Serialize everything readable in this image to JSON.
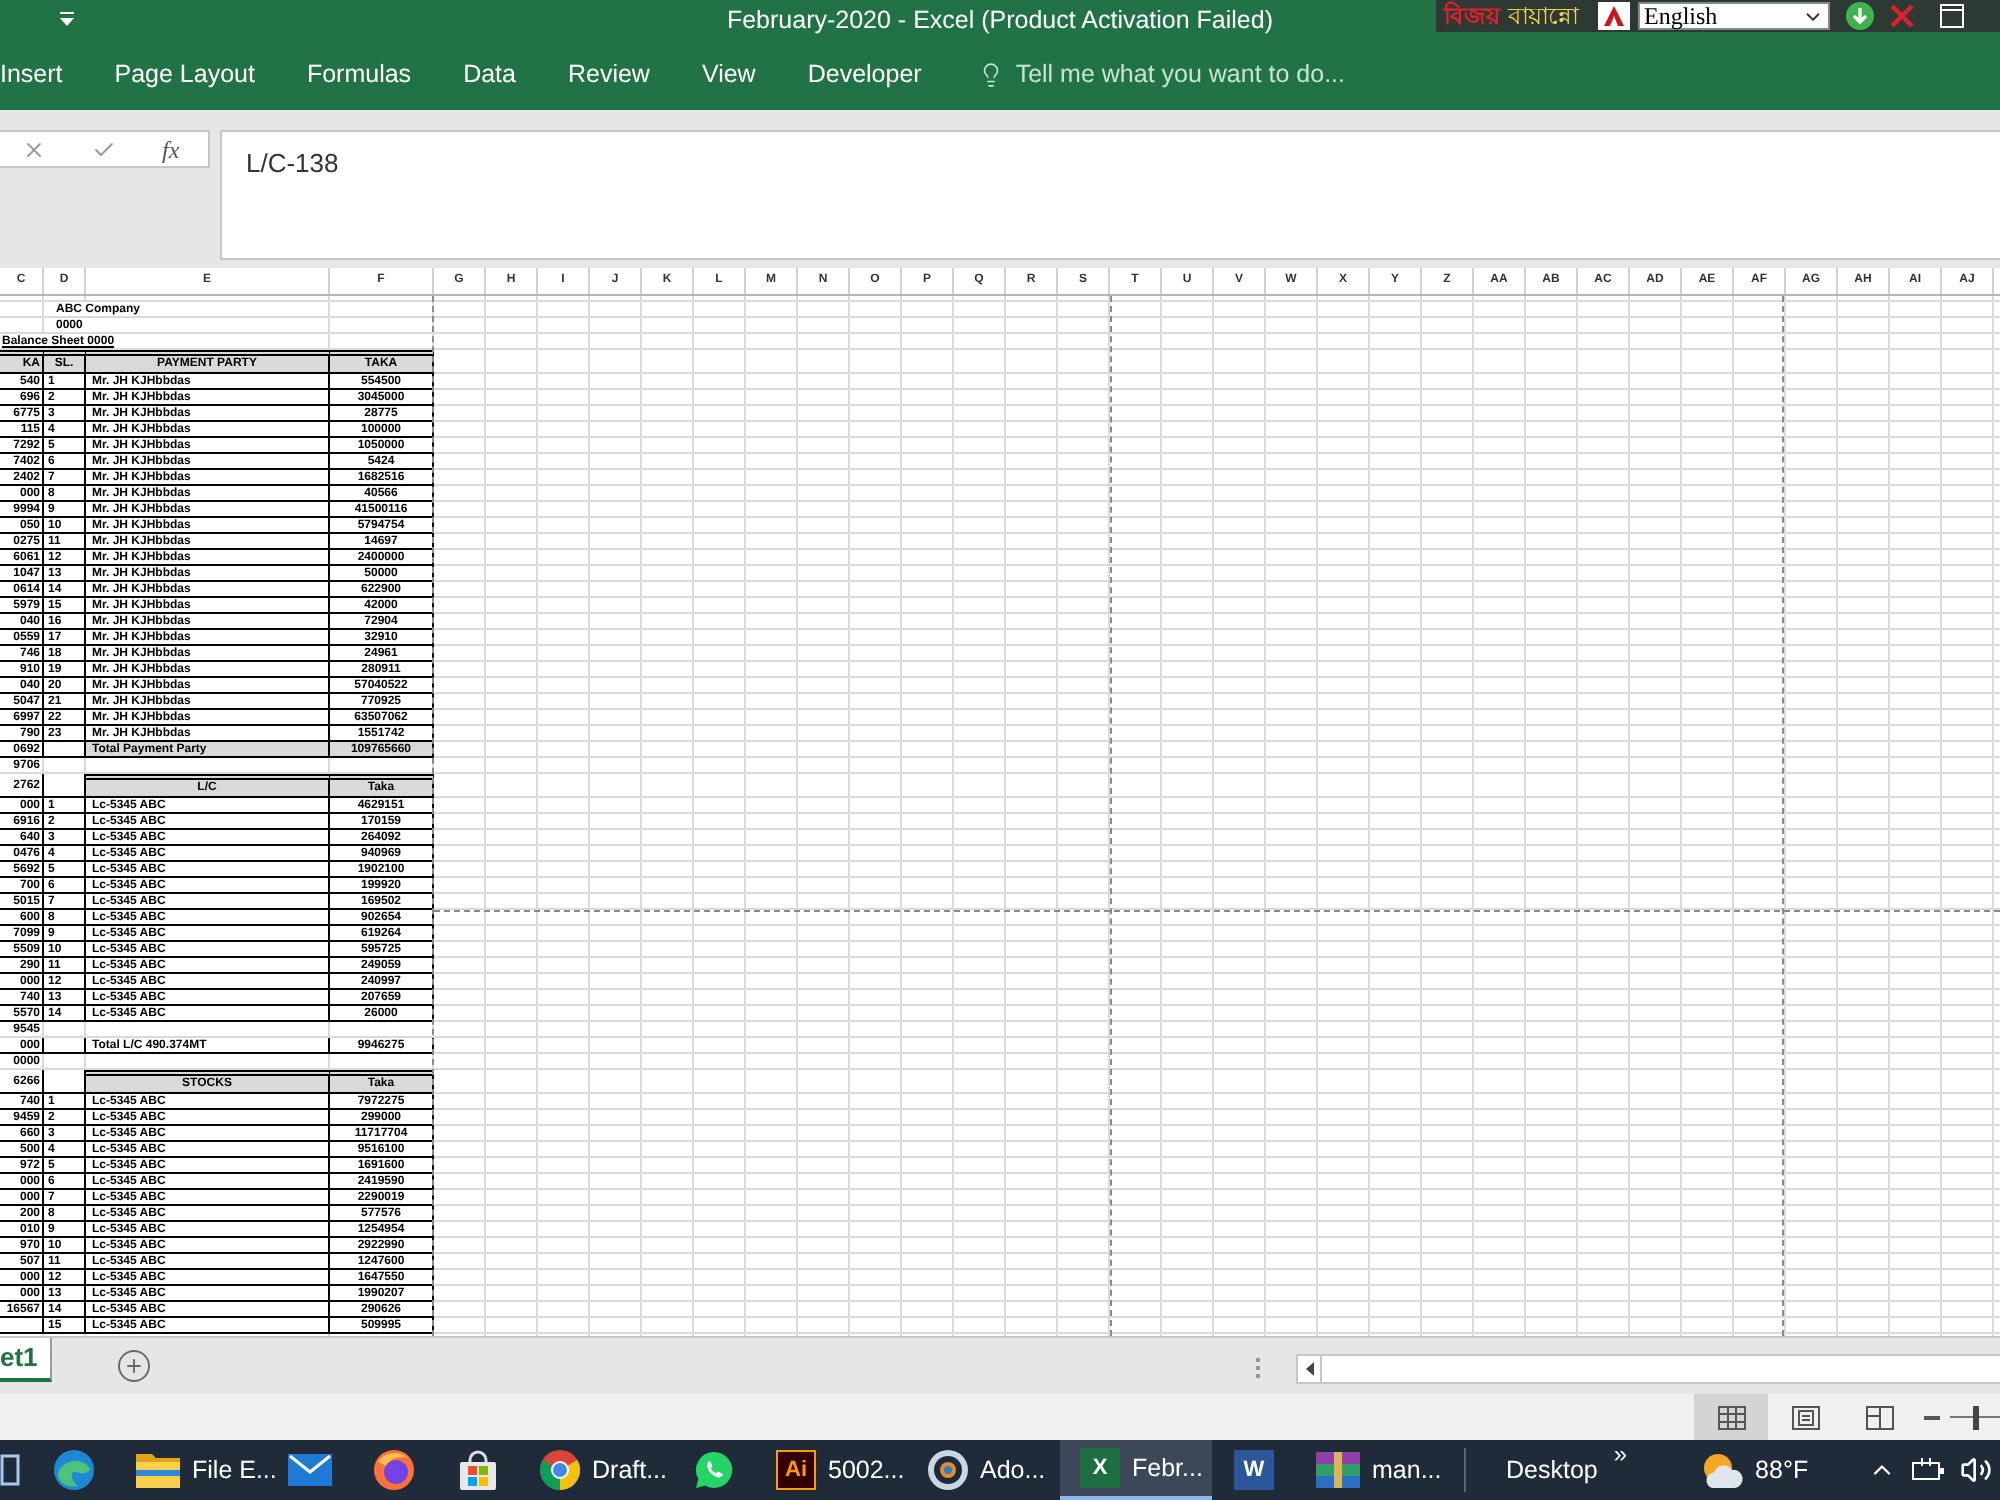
{
  "title_bar": {
    "title": "February-2020 - Excel (Product Activation Failed)"
  },
  "keyboard_toolbar": {
    "brand": "বিজয়",
    "name": "বায়ান্নো",
    "language": "English"
  },
  "ribbon_tabs": [
    {
      "label": "Insert",
      "selected": false
    },
    {
      "label": "Page Layout",
      "selected": false
    },
    {
      "label": "Formulas",
      "selected": false
    },
    {
      "label": "Data",
      "selected": false
    },
    {
      "label": "Review",
      "selected": false
    },
    {
      "label": "View",
      "selected": false
    },
    {
      "label": "Developer",
      "selected": false
    }
  ],
  "tell_me": {
    "placeholder": "Tell me what you want to do..."
  },
  "formula_bar": {
    "function_label": "fx",
    "value": "L/C-138"
  },
  "sheet": {
    "columns": [
      "C",
      "D",
      "E",
      "F",
      "G",
      "H",
      "I",
      "J",
      "K",
      "L",
      "M",
      "N",
      "O",
      "P",
      "Q",
      "R",
      "S",
      "T",
      "U",
      "V",
      "W",
      "X",
      "Y",
      "Z",
      "AA",
      "AB",
      "AC",
      "AD",
      "AE",
      "AF",
      "AG",
      "AH",
      "AI",
      "AJ"
    ],
    "rows": [
      {
        "kind": "note",
        "d": "ABC Company"
      },
      {
        "kind": "note",
        "d": "0000"
      },
      {
        "kind": "title",
        "c": "Balance Sheet 0000"
      },
      {
        "kind": "header",
        "c": "KA",
        "d": "SL.",
        "e": "PAYMENT PARTY",
        "f": "TAKA"
      },
      {
        "kind": "item",
        "c": "540",
        "d": "1",
        "e": "Mr. JH KJHbbdas",
        "f": "554500"
      },
      {
        "kind": "item",
        "c": "696",
        "d": "2",
        "e": "Mr. JH KJHbbdas",
        "f": "3045000"
      },
      {
        "kind": "item",
        "c": "6775",
        "d": "3",
        "e": "Mr. JH KJHbbdas",
        "f": "28775"
      },
      {
        "kind": "item",
        "c": "115",
        "d": "4",
        "e": "Mr. JH KJHbbdas",
        "f": "100000"
      },
      {
        "kind": "item",
        "c": "7292",
        "d": "5",
        "e": "Mr. JH KJHbbdas",
        "f": "1050000"
      },
      {
        "kind": "item",
        "c": "7402",
        "d": "6",
        "e": "Mr. JH KJHbbdas",
        "f": "5424"
      },
      {
        "kind": "item",
        "c": "2402",
        "d": "7",
        "e": "Mr. JH KJHbbdas",
        "f": "1682516"
      },
      {
        "kind": "item",
        "c": "000",
        "d": "8",
        "e": "Mr. JH KJHbbdas",
        "f": "40566"
      },
      {
        "kind": "item",
        "c": "9994",
        "d": "9",
        "e": "Mr. JH KJHbbdas",
        "f": "41500116"
      },
      {
        "kind": "item",
        "c": "050",
        "d": "10",
        "e": "Mr. JH KJHbbdas",
        "f": "5794754"
      },
      {
        "kind": "item",
        "c": "0275",
        "d": "11",
        "e": "Mr. JH KJHbbdas",
        "f": "14697"
      },
      {
        "kind": "item",
        "c": "6061",
        "d": "12",
        "e": "Mr. JH KJHbbdas",
        "f": "2400000"
      },
      {
        "kind": "item",
        "c": "1047",
        "d": "13",
        "e": "Mr. JH KJHbbdas",
        "f": "50000"
      },
      {
        "kind": "item",
        "c": "0614",
        "d": "14",
        "e": "Mr. JH KJHbbdas",
        "f": "622900"
      },
      {
        "kind": "item",
        "c": "5979",
        "d": "15",
        "e": "Mr. JH KJHbbdas",
        "f": "42000"
      },
      {
        "kind": "item",
        "c": "040",
        "d": "16",
        "e": "Mr. JH KJHbbdas",
        "f": "72904"
      },
      {
        "kind": "item",
        "c": "0559",
        "d": "17",
        "e": "Mr. JH KJHbbdas",
        "f": "32910"
      },
      {
        "kind": "item",
        "c": "746",
        "d": "18",
        "e": "Mr. JH KJHbbdas",
        "f": "24961"
      },
      {
        "kind": "item",
        "c": "910",
        "d": "19",
        "e": "Mr. JH KJHbbdas",
        "f": "280911"
      },
      {
        "kind": "item",
        "c": "040",
        "d": "20",
        "e": "Mr. JH KJHbbdas",
        "f": "57040522"
      },
      {
        "kind": "item",
        "c": "5047",
        "d": "21",
        "e": "Mr. JH KJHbbdas",
        "f": "770925"
      },
      {
        "kind": "item",
        "c": "6997",
        "d": "22",
        "e": "Mr. JH KJHbbdas",
        "f": "63507062"
      },
      {
        "kind": "item",
        "c": "790",
        "d": "23",
        "e": "Mr. JH KJHbbdas",
        "f": "1551742"
      },
      {
        "kind": "total",
        "c": "0692",
        "e": "Total Payment Party",
        "f": "109765660"
      },
      {
        "kind": "note",
        "c": "9706"
      },
      {
        "kind": "header",
        "c": "2762",
        "e": "L/C",
        "f": "Taka"
      },
      {
        "kind": "item",
        "c": "000",
        "d": "1",
        "e": "Lc-5345 ABC",
        "f": "4629151"
      },
      {
        "kind": "item",
        "c": "6916",
        "d": "2",
        "e": "Lc-5345 ABC",
        "f": "170159"
      },
      {
        "kind": "item",
        "c": "640",
        "d": "3",
        "e": "Lc-5345 ABC",
        "f": "264092"
      },
      {
        "kind": "item",
        "c": "0476",
        "d": "4",
        "e": "Lc-5345 ABC",
        "f": "940969"
      },
      {
        "kind": "item",
        "c": "5692",
        "d": "5",
        "e": "Lc-5345 ABC",
        "f": "1902100"
      },
      {
        "kind": "item",
        "c": "700",
        "d": "6",
        "e": "Lc-5345 ABC",
        "f": "199920"
      },
      {
        "kind": "item",
        "c": "5015",
        "d": "7",
        "e": "Lc-5345 ABC",
        "f": "169502"
      },
      {
        "kind": "item",
        "c": "600",
        "d": "8",
        "e": "Lc-5345 ABC",
        "f": "902654"
      },
      {
        "kind": "item",
        "c": "7099",
        "d": "9",
        "e": "Lc-5345 ABC",
        "f": "619264"
      },
      {
        "kind": "item",
        "c": "5509",
        "d": "10",
        "e": "Lc-5345 ABC",
        "f": "595725"
      },
      {
        "kind": "item",
        "c": "290",
        "d": "11",
        "e": "Lc-5345 ABC",
        "f": "249059"
      },
      {
        "kind": "item",
        "c": "000",
        "d": "12",
        "e": "Lc-5345 ABC",
        "f": "240997"
      },
      {
        "kind": "item",
        "c": "740",
        "d": "13",
        "e": "Lc-5345 ABC",
        "f": "207659"
      },
      {
        "kind": "item",
        "c": "5570",
        "d": "14",
        "e": "Lc-5345 ABC",
        "f": "26000"
      },
      {
        "kind": "note",
        "c": "9545"
      },
      {
        "kind": "subtotal",
        "c": "000",
        "e": "Total L/C 490.374MT",
        "f": "9946275"
      },
      {
        "kind": "note",
        "c": "0000"
      },
      {
        "kind": "header",
        "c": "6266",
        "e": "STOCKS",
        "f": "Taka"
      },
      {
        "kind": "item",
        "c": "740",
        "d": "1",
        "e": "Lc-5345 ABC",
        "f": "7972275"
      },
      {
        "kind": "item",
        "c": "9459",
        "d": "2",
        "e": "Lc-5345 ABC",
        "f": "299000"
      },
      {
        "kind": "item",
        "c": "660",
        "d": "3",
        "e": "Lc-5345 ABC",
        "f": "11717704"
      },
      {
        "kind": "item",
        "c": "500",
        "d": "4",
        "e": "Lc-5345 ABC",
        "f": "9516100"
      },
      {
        "kind": "item",
        "c": "972",
        "d": "5",
        "e": "Lc-5345 ABC",
        "f": "1691600"
      },
      {
        "kind": "item",
        "c": "000",
        "d": "6",
        "e": "Lc-5345 ABC",
        "f": "2419590"
      },
      {
        "kind": "item",
        "c": "000",
        "d": "7",
        "e": "Lc-5345 ABC",
        "f": "2290019"
      },
      {
        "kind": "item",
        "c": "200",
        "d": "8",
        "e": "Lc-5345 ABC",
        "f": "577576"
      },
      {
        "kind": "item",
        "c": "010",
        "d": "9",
        "e": "Lc-5345 ABC",
        "f": "1254954"
      },
      {
        "kind": "item",
        "c": "970",
        "d": "10",
        "e": "Lc-5345 ABC",
        "f": "2922990"
      },
      {
        "kind": "item",
        "c": "507",
        "d": "11",
        "e": "Lc-5345 ABC",
        "f": "1247600"
      },
      {
        "kind": "item",
        "c": "000",
        "d": "12",
        "e": "Lc-5345 ABC",
        "f": "1647550"
      },
      {
        "kind": "item",
        "c": "000",
        "d": "13",
        "e": "Lc-5345 ABC",
        "f": "1990207"
      },
      {
        "kind": "item",
        "c": "16567",
        "d": "14",
        "e": "Lc-5345 ABC",
        "f": "290626"
      },
      {
        "kind": "item",
        "d": "15",
        "e": "Lc-5345 ABC",
        "f": "509995"
      }
    ]
  },
  "sheet_tabs": [
    {
      "label": "et1",
      "selected": true
    }
  ],
  "status_bar": {
    "views": [
      {
        "kind": "normal",
        "selected": true
      },
      {
        "kind": "page_layout",
        "selected": false
      },
      {
        "kind": "page_break",
        "selected": false
      }
    ],
    "zoom": {
      "level": 0.5
    }
  },
  "taskbar": {
    "apps": [
      {
        "kind": "task_view",
        "selected": false
      },
      {
        "kind": "edge",
        "selected": false
      },
      {
        "kind": "explorer",
        "label": "File E...",
        "selected": false
      },
      {
        "kind": "mail",
        "selected": false
      },
      {
        "kind": "firefox",
        "selected": false
      },
      {
        "kind": "store",
        "selected": false
      },
      {
        "kind": "chrome",
        "label": "Draft...",
        "selected": false
      },
      {
        "kind": "whatsapp",
        "selected": false
      },
      {
        "kind": "illustrator",
        "glyph": "Ai",
        "label": "5002...",
        "selected": false
      },
      {
        "kind": "adobe",
        "label": "Ado...",
        "selected": false
      },
      {
        "kind": "excel",
        "glyph": "X",
        "label": "Febr...",
        "selected": true
      },
      {
        "kind": "word",
        "glyph": "W",
        "selected": false
      },
      {
        "kind": "winrar",
        "label": "man...",
        "selected": false
      }
    ],
    "desktop": "Desktop",
    "overflow": "»",
    "weather": "88°F"
  }
}
